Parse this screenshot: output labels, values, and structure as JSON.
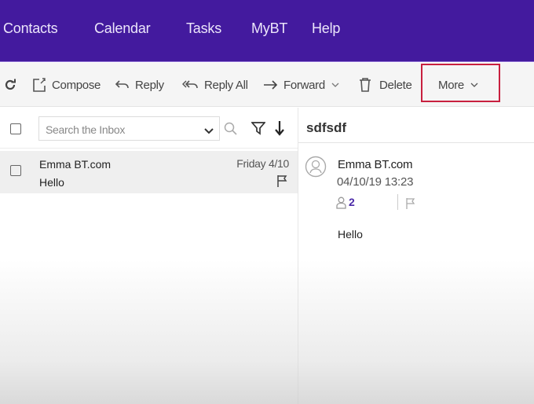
{
  "topnav": {
    "items": [
      {
        "label": "Contacts"
      },
      {
        "label": "Calendar"
      },
      {
        "label": "Tasks"
      },
      {
        "label": "MyBT"
      },
      {
        "label": "Help"
      }
    ],
    "color": "#431a9e"
  },
  "toolbar": {
    "refresh_icon": "refresh-icon",
    "compose_label": "Compose",
    "reply_label": "Reply",
    "reply_all_label": "Reply All",
    "forward_label": "Forward",
    "delete_label": "Delete",
    "more_label": "More",
    "highlight_color": "#c8203f"
  },
  "message_list": {
    "search": {
      "placeholder": "Search the Inbox",
      "value": ""
    },
    "messages": [
      {
        "from": "Emma BT.com",
        "subject": "Hello",
        "date": "Friday 4/10",
        "flagged": false,
        "selected": true
      }
    ]
  },
  "reading_pane": {
    "subject": "sdfsdf",
    "sender": "Emma BT.com",
    "date": "04/10/19 13:23",
    "recipient_count": "2",
    "body": "Hello"
  }
}
